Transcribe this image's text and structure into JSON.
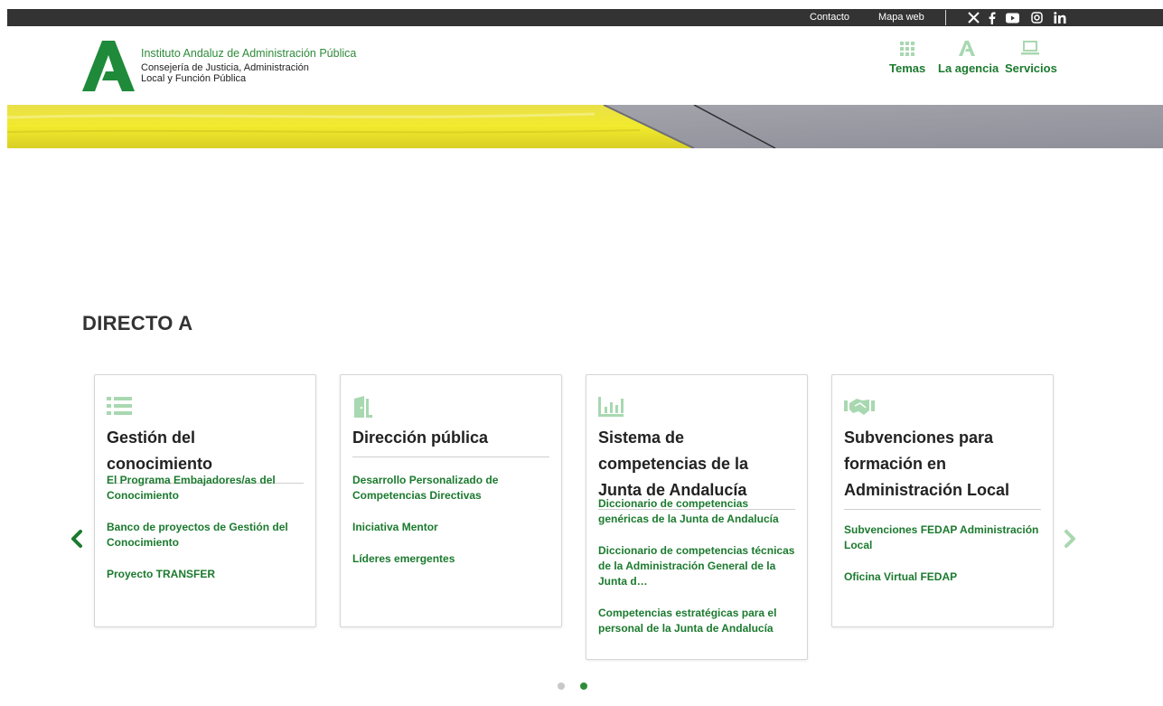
{
  "topbar": {
    "links": [
      "Contacto",
      "Mapa web"
    ],
    "social": [
      "x-icon",
      "facebook-icon",
      "youtube-icon",
      "instagram-icon",
      "linkedin-icon"
    ]
  },
  "header": {
    "org_title": "Instituto Andaluz de Administración Pública",
    "org_subtitle_1": "Consejería de Justicia, Administración",
    "org_subtitle_2": "Local y Función Pública",
    "nav": [
      {
        "label": "Temas",
        "icon": "grid-icon"
      },
      {
        "label": "La agencia",
        "icon": "agency-logo-icon"
      },
      {
        "label": "Servicios",
        "icon": "laptop-icon"
      }
    ]
  },
  "section": {
    "title": "DIRECTO A"
  },
  "cards": [
    {
      "icon": "list-icon",
      "title": "Gestión del conocimiento",
      "links": [
        "El Programa Embajadores/as del Conocimiento",
        "Banco de proyectos de Gestión del Conocimiento",
        "Proyecto TRANSFER"
      ]
    },
    {
      "icon": "door-icon",
      "title": "Dirección pública",
      "links": [
        "Desarrollo Personalizado de Competencias Directivas",
        "Iniciativa Mentor",
        "Líderes emergentes"
      ]
    },
    {
      "icon": "bar-chart-icon",
      "title": "Sistema de competencias de la Junta de Andalucía",
      "links": [
        "Diccionario de competencias genéricas de la Junta de Andalucía",
        "Diccionario de competencias técnicas de la Administración General de la Junta d…",
        "Competencias estratégicas para el personal de la Junta de Andalucía"
      ]
    },
    {
      "icon": "handshake-icon",
      "title": "Subvenciones para formación en Administración Local",
      "links": [
        "Subvenciones FEDAP Administración Local",
        "Oficina Virtual FEDAP"
      ]
    }
  ],
  "carousel": {
    "active_page": 2,
    "pages": 2
  },
  "colors": {
    "brand_green": "#1b7a2e",
    "light_green": "#a8d8b0",
    "topbar": "#333333"
  }
}
